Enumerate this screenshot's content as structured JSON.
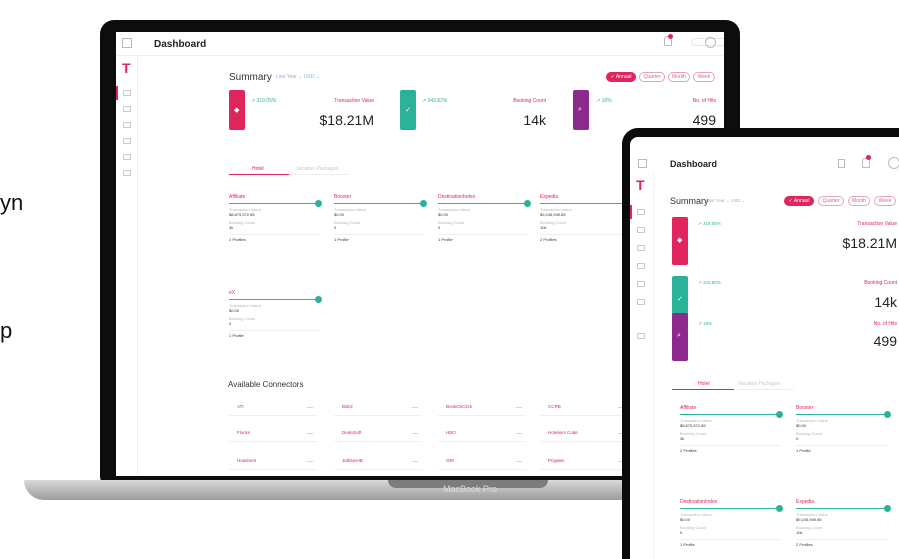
{
  "side_text": {
    "line1": "yn",
    "line2": "p"
  },
  "laptop": {
    "device_label": "MacBook Pro",
    "title": "Dashboard",
    "summary": {
      "title": "Summary",
      "last_year": "Last Year ⌄ USD ⌄",
      "periods": [
        "✓ Annual",
        "Quarter",
        "Month",
        "Week"
      ]
    },
    "kpis": [
      {
        "trend": "↗ 319.05%",
        "label": "Transaction Value",
        "value": "$18.21M",
        "color": "#e0245e"
      },
      {
        "trend": "↗ 343.82%",
        "label": "Booking Count",
        "value": "14k",
        "color": "#2bb39a"
      },
      {
        "trend": "↗ 16%",
        "label": "No. of Hits",
        "value": "499",
        "color": "#8e2a8e"
      }
    ],
    "tabs": [
      "Hotel",
      "Vacation Packages"
    ],
    "profiles": [
      {
        "name": "Affiliate",
        "tx_label": "Transaction Value",
        "tx_value": "$8,875,572.85",
        "bc_label": "Booking Count",
        "bc_value": "3k",
        "profiles": "2 Profiles"
      },
      {
        "name": "Booster",
        "tx_label": "Transaction Value",
        "tx_value": "$0.00",
        "bc_label": "Booking Count",
        "bc_value": "0",
        "profiles": "1 Profile"
      },
      {
        "name": "DestinationIndex",
        "tx_label": "Transaction Value",
        "tx_value": "$0.00",
        "bc_label": "Booking Count",
        "bc_value": "0",
        "profiles": "1 Profile"
      },
      {
        "name": "Expedia",
        "tx_label": "Transaction Value",
        "tx_value": "$9,245,949.85",
        "bc_label": "Booking Count",
        "bc_value": "10k",
        "profiles": "2 Profiles"
      },
      {
        "name": "eX",
        "tx_label": "Transaction Value",
        "tx_value": "$0.00",
        "bc_label": "Booking Count",
        "bc_value": "0",
        "profiles": "1 Profile"
      }
    ],
    "connectors_title": "Available Connectors",
    "connectors": [
      "ATI",
      "Bidrd",
      "BookOnClick",
      "CCRB",
      "Flocks",
      "DealsSoft",
      "HBO",
      "Hoteliers Code",
      "Hotelnest",
      "JetblueHB",
      "ORI",
      "Prigalen"
    ]
  },
  "tablet": {
    "title": "Dashboard",
    "summary": {
      "title": "Summary",
      "last_year": "Last Year ⌄ USD ⌄",
      "periods": [
        "✓ Annual",
        "Quarter",
        "Month",
        "Week"
      ]
    },
    "kpis": [
      {
        "trend": "↗ 319.05%",
        "label": "Transaction Value",
        "value": "$18.21M",
        "color": "#e0245e"
      },
      {
        "trend": "↗ 343.82%",
        "label": "Booking Count",
        "value": "14k",
        "color": "#2bb39a"
      },
      {
        "trend": "↗ 16%",
        "label": "No. of Hits",
        "value": "499",
        "color": "#8e2a8e"
      }
    ],
    "tabs": [
      "Hotel",
      "Vacation Packages"
    ],
    "profiles": [
      {
        "name": "Affiliate",
        "tx_label": "Transaction Value",
        "tx_value": "$8,875,572.85",
        "bc_label": "Booking Count",
        "bc_value": "3k",
        "profiles": "2 Profiles"
      },
      {
        "name": "Booster",
        "tx_label": "Transaction Value",
        "tx_value": "$0.00",
        "bc_label": "Booking Count",
        "bc_value": "0",
        "profiles": "1 Profile"
      },
      {
        "name": "DestinationIndex",
        "tx_label": "Transaction Value",
        "tx_value": "$0.00",
        "bc_label": "Booking Count",
        "bc_value": "0",
        "profiles": "1 Profile"
      },
      {
        "name": "Expedia",
        "tx_label": "Transaction Value",
        "tx_value": "$9,245,949.85",
        "bc_label": "Booking Count",
        "bc_value": "10k",
        "profiles": "2 Profiles"
      }
    ]
  }
}
